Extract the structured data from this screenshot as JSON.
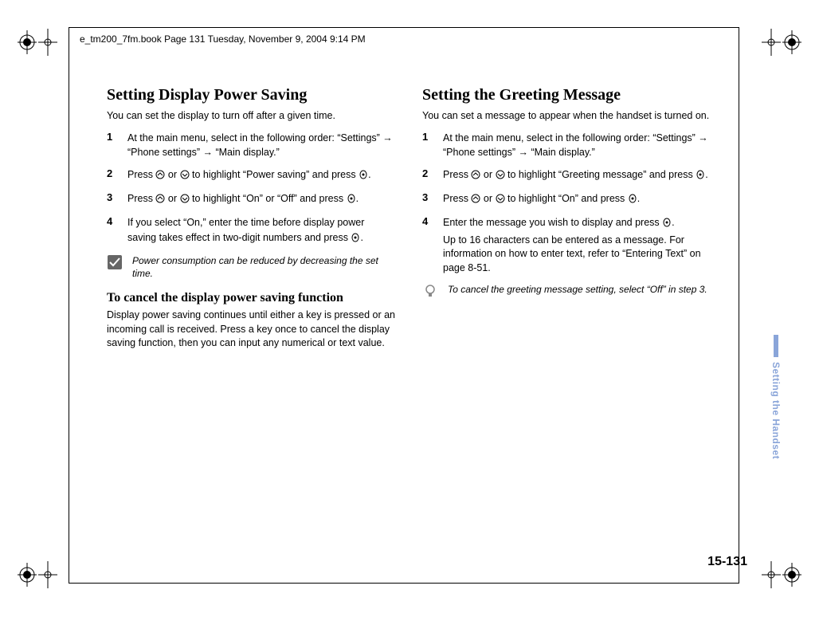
{
  "header": "e_tm200_7fm.book  Page 131  Tuesday, November 9, 2004  9:14 PM",
  "left": {
    "title": "Setting Display Power Saving",
    "intro": "You can set the display to turn off after a given time.",
    "steps": {
      "s1": "At the main menu, select in the following order: “Settings” → “Phone settings” → “Main display.”",
      "s2a": "Press ",
      "s2b": " or ",
      "s2c": " to highlight “Power saving” and press ",
      "s2d": ".",
      "s3a": "Press ",
      "s3b": " or ",
      "s3c": " to highlight “On” or “Off” and press ",
      "s3d": ".",
      "s4a": "If you select “On,” enter the time before display power saving takes effect in two-digit numbers and press ",
      "s4b": "."
    },
    "note": "Power consumption can be reduced by decreasing the set time.",
    "sub_title": "To cancel the display power saving function",
    "sub_para": "Display power saving continues until either a key is pressed or an incoming call is received. Press a key once to cancel the display saving function, then you can input any numerical or text value."
  },
  "right": {
    "title": "Setting the Greeting Message",
    "intro": "You can set a message to appear when the handset is turned on.",
    "steps": {
      "s1": "At the main menu, select in the following order: “Settings” → “Phone settings” → “Main display.”",
      "s2a": "Press ",
      "s2b": " or ",
      "s2c": " to highlight “Greeting message” and press ",
      "s2d": ".",
      "s3a": "Press ",
      "s3b": " or ",
      "s3c": " to highlight “On” and press ",
      "s3d": ".",
      "s4a": "Enter the message you wish to display and press ",
      "s4b": ".",
      "s4c": "Up to 16 characters can be entered as a message. For information on how to enter text, refer to “Entering Text” on page 8-51."
    },
    "note": "To cancel the greeting message setting, select “Off” in step 3."
  },
  "nums": {
    "n1": "1",
    "n2": "2",
    "n3": "3",
    "n4": "4"
  },
  "side_label": "Setting the Handset",
  "page_number": "15-131"
}
